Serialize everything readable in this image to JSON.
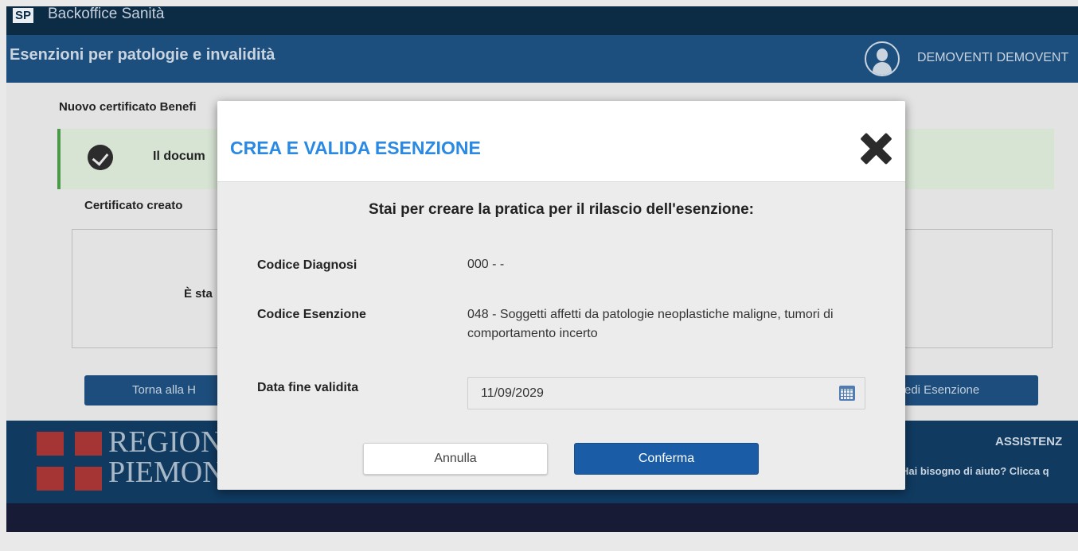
{
  "app": {
    "logo": "SP",
    "title": "Backoffice Sanità"
  },
  "header": {
    "title": "Esenzioni per patologie e invalidità",
    "user_name": "DEMOVENTI DEMOVENT"
  },
  "background": {
    "page_heading": "Nuovo certificato Benefi",
    "alert_text": "Il docum",
    "cert_label": "Certificato creato",
    "cert_text": "È sta",
    "back_button": "Torna alla H",
    "view_button": "edi Esenzione"
  },
  "footer": {
    "region_line1": "REGIONE",
    "region_line2": "PIEMONTE",
    "assist_title": "ASSISTENZ",
    "assist_text": "Hai bisogno di aiuto? Clicca q"
  },
  "modal": {
    "title": "CREA E VALIDA ESENZIONE",
    "subtitle": "Stai per creare la pratica per il rilascio dell'esenzione:",
    "fields": {
      "diagnosi_label": "Codice Diagnosi",
      "diagnosi_value": "000 - -",
      "esenzione_label": "Codice Esenzione",
      "esenzione_value": "048 - Soggetti affetti da patologie neoplastiche maligne, tumori di comportamento incerto",
      "data_label": "Data fine validita",
      "data_value": "11/09/2029"
    },
    "cancel_label": "Annulla",
    "confirm_label": "Conferma"
  },
  "colors": {
    "topbar": "#0c2b45",
    "subheader": "#1c4f7e",
    "modal_title": "#2a8ae3",
    "confirm_button": "#1a5da6",
    "footer": "#103a60"
  },
  "icons": [
    "avatar-icon",
    "check-circle-icon",
    "close-icon",
    "calendar-icon"
  ]
}
